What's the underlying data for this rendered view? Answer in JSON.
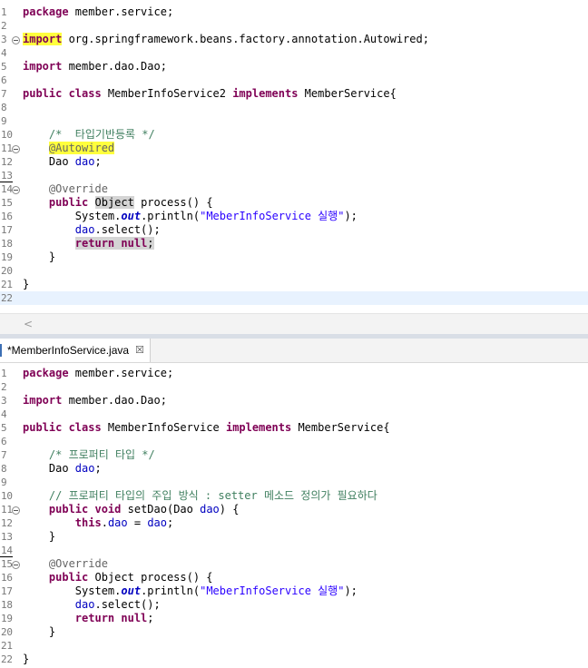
{
  "editor1": {
    "lines": [
      {
        "n": "1",
        "segs": [
          {
            "c": "kw",
            "t": "package"
          },
          {
            "t": " member.service;"
          }
        ]
      },
      {
        "n": "2",
        "segs": []
      },
      {
        "n": "3",
        "fold": true,
        "segs": [
          {
            "c": "kw hl",
            "t": "import"
          },
          {
            "t": " org.springframework.beans.factory.annotation.Autowired;"
          }
        ]
      },
      {
        "n": "4",
        "segs": []
      },
      {
        "n": "5",
        "segs": [
          {
            "c": "kw",
            "t": "import"
          },
          {
            "t": " member.dao.Dao;"
          }
        ]
      },
      {
        "n": "6",
        "segs": []
      },
      {
        "n": "7",
        "segs": [
          {
            "c": "kw",
            "t": "public class"
          },
          {
            "t": " MemberInfoService2 "
          },
          {
            "c": "kw",
            "t": "implements"
          },
          {
            "t": " MemberService{"
          }
        ]
      },
      {
        "n": "8",
        "segs": []
      },
      {
        "n": "9",
        "segs": []
      },
      {
        "n": "10",
        "segs": [
          {
            "t": "    "
          },
          {
            "c": "cm",
            "t": "/*  타입기반등록 */"
          }
        ]
      },
      {
        "n": "11",
        "fold": true,
        "segs": [
          {
            "t": "    "
          },
          {
            "c": "ann hl",
            "t": "@Autowired"
          }
        ]
      },
      {
        "n": "12",
        "segs": [
          {
            "t": "    Dao "
          },
          {
            "c": "fld",
            "t": "dao"
          },
          {
            "t": ";"
          }
        ]
      },
      {
        "n": "13",
        "caret": true,
        "segs": []
      },
      {
        "n": "14",
        "fold": true,
        "segs": [
          {
            "t": "    "
          },
          {
            "c": "ann",
            "t": "@Override"
          }
        ]
      },
      {
        "n": "15",
        "segs": [
          {
            "t": "    "
          },
          {
            "c": "kw",
            "t": "public"
          },
          {
            "t": " "
          },
          {
            "c": "occ",
            "t": "Object"
          },
          {
            "t": " process() {"
          }
        ]
      },
      {
        "n": "16",
        "segs": [
          {
            "t": "        System."
          },
          {
            "c": "sfld",
            "t": "out"
          },
          {
            "t": ".println("
          },
          {
            "c": "str",
            "t": "\"MeberInfoService 실행\""
          },
          {
            "t": ");"
          }
        ]
      },
      {
        "n": "17",
        "segs": [
          {
            "t": "        "
          },
          {
            "c": "fld",
            "t": "dao"
          },
          {
            "t": ".select();"
          }
        ]
      },
      {
        "n": "18",
        "segs": [
          {
            "t": "        "
          },
          {
            "c": "kw occ",
            "t": "return"
          },
          {
            "c": "occ",
            "t": " "
          },
          {
            "c": "kw occ",
            "t": "null"
          },
          {
            "c": "occ",
            "t": ";"
          }
        ]
      },
      {
        "n": "19",
        "segs": [
          {
            "t": "    }"
          }
        ]
      },
      {
        "n": "20",
        "segs": []
      },
      {
        "n": "21",
        "segs": [
          {
            "t": "}"
          }
        ]
      },
      {
        "n": "22",
        "current": true,
        "segs": []
      }
    ],
    "scroll_left": "<"
  },
  "tab": {
    "label": "*MemberInfoService.java",
    "close": "☒"
  },
  "editor2": {
    "lines": [
      {
        "n": "1",
        "segs": [
          {
            "c": "kw",
            "t": "package"
          },
          {
            "t": " member.service;"
          }
        ]
      },
      {
        "n": "2",
        "segs": []
      },
      {
        "n": "3",
        "segs": [
          {
            "c": "kw",
            "t": "import"
          },
          {
            "t": " member.dao.Dao;"
          }
        ]
      },
      {
        "n": "4",
        "segs": []
      },
      {
        "n": "5",
        "segs": [
          {
            "c": "kw",
            "t": "public class"
          },
          {
            "t": " MemberInfoService "
          },
          {
            "c": "kw",
            "t": "implements"
          },
          {
            "t": " MemberService{"
          }
        ]
      },
      {
        "n": "6",
        "segs": []
      },
      {
        "n": "7",
        "segs": [
          {
            "t": "    "
          },
          {
            "c": "cm",
            "t": "/* 프로퍼티 타입 */"
          }
        ]
      },
      {
        "n": "8",
        "segs": [
          {
            "t": "    Dao "
          },
          {
            "c": "fld",
            "t": "dao"
          },
          {
            "t": ";"
          }
        ]
      },
      {
        "n": "9",
        "segs": []
      },
      {
        "n": "10",
        "segs": [
          {
            "t": "    "
          },
          {
            "c": "cm",
            "t": "// 프로퍼티 타입의 주입 방식 : setter 메소드 정의가 필요하다"
          }
        ]
      },
      {
        "n": "11",
        "fold": true,
        "segs": [
          {
            "t": "    "
          },
          {
            "c": "kw",
            "t": "public void"
          },
          {
            "t": " setDao(Dao "
          },
          {
            "c": "fld",
            "t": "dao"
          },
          {
            "t": ") {"
          }
        ]
      },
      {
        "n": "12",
        "segs": [
          {
            "t": "        "
          },
          {
            "c": "kw",
            "t": "this"
          },
          {
            "t": "."
          },
          {
            "c": "fld",
            "t": "dao"
          },
          {
            "t": " = "
          },
          {
            "c": "fld",
            "t": "dao"
          },
          {
            "t": ";"
          }
        ]
      },
      {
        "n": "13",
        "segs": [
          {
            "t": "    }"
          }
        ]
      },
      {
        "n": "14",
        "caret": true,
        "segs": []
      },
      {
        "n": "15",
        "fold": true,
        "segs": [
          {
            "t": "    "
          },
          {
            "c": "ann",
            "t": "@Override"
          }
        ]
      },
      {
        "n": "16",
        "segs": [
          {
            "t": "    "
          },
          {
            "c": "kw",
            "t": "public"
          },
          {
            "t": " Object process() {"
          }
        ]
      },
      {
        "n": "17",
        "segs": [
          {
            "t": "        System."
          },
          {
            "c": "sfld",
            "t": "out"
          },
          {
            "t": ".println("
          },
          {
            "c": "str",
            "t": "\"MeberInfoService 실행\""
          },
          {
            "t": ");"
          }
        ]
      },
      {
        "n": "18",
        "segs": [
          {
            "t": "        "
          },
          {
            "c": "fld",
            "t": "dao"
          },
          {
            "t": ".select();"
          }
        ]
      },
      {
        "n": "19",
        "segs": [
          {
            "t": "        "
          },
          {
            "c": "kw",
            "t": "return null"
          },
          {
            "t": ";"
          }
        ]
      },
      {
        "n": "20",
        "segs": [
          {
            "t": "    }"
          }
        ]
      },
      {
        "n": "21",
        "segs": []
      },
      {
        "n": "22",
        "segs": [
          {
            "t": "}"
          }
        ]
      }
    ]
  },
  "colors": {
    "keyword": "#7f0055",
    "comment": "#3f7f5f",
    "annotation": "#646464",
    "string": "#2a00ff",
    "field": "#0000c0",
    "highlight": "#ffff3d",
    "current_line": "#e8f2fe"
  }
}
